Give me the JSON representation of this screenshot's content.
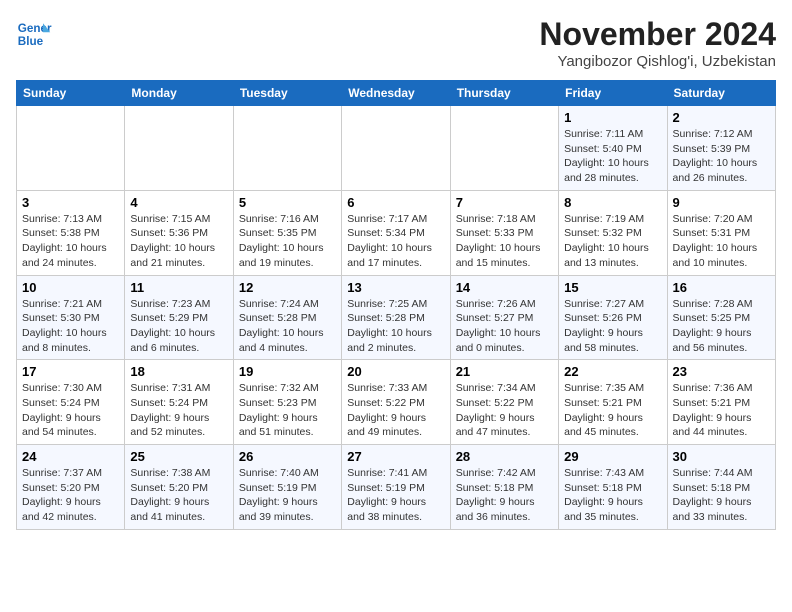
{
  "header": {
    "logo_line1": "General",
    "logo_line2": "Blue",
    "month": "November 2024",
    "location": "Yangibozor Qishlog'i, Uzbekistan"
  },
  "weekdays": [
    "Sunday",
    "Monday",
    "Tuesday",
    "Wednesday",
    "Thursday",
    "Friday",
    "Saturday"
  ],
  "weeks": [
    [
      {
        "day": "",
        "info": ""
      },
      {
        "day": "",
        "info": ""
      },
      {
        "day": "",
        "info": ""
      },
      {
        "day": "",
        "info": ""
      },
      {
        "day": "",
        "info": ""
      },
      {
        "day": "1",
        "info": "Sunrise: 7:11 AM\nSunset: 5:40 PM\nDaylight: 10 hours and 28 minutes."
      },
      {
        "day": "2",
        "info": "Sunrise: 7:12 AM\nSunset: 5:39 PM\nDaylight: 10 hours and 26 minutes."
      }
    ],
    [
      {
        "day": "3",
        "info": "Sunrise: 7:13 AM\nSunset: 5:38 PM\nDaylight: 10 hours and 24 minutes."
      },
      {
        "day": "4",
        "info": "Sunrise: 7:15 AM\nSunset: 5:36 PM\nDaylight: 10 hours and 21 minutes."
      },
      {
        "day": "5",
        "info": "Sunrise: 7:16 AM\nSunset: 5:35 PM\nDaylight: 10 hours and 19 minutes."
      },
      {
        "day": "6",
        "info": "Sunrise: 7:17 AM\nSunset: 5:34 PM\nDaylight: 10 hours and 17 minutes."
      },
      {
        "day": "7",
        "info": "Sunrise: 7:18 AM\nSunset: 5:33 PM\nDaylight: 10 hours and 15 minutes."
      },
      {
        "day": "8",
        "info": "Sunrise: 7:19 AM\nSunset: 5:32 PM\nDaylight: 10 hours and 13 minutes."
      },
      {
        "day": "9",
        "info": "Sunrise: 7:20 AM\nSunset: 5:31 PM\nDaylight: 10 hours and 10 minutes."
      }
    ],
    [
      {
        "day": "10",
        "info": "Sunrise: 7:21 AM\nSunset: 5:30 PM\nDaylight: 10 hours and 8 minutes."
      },
      {
        "day": "11",
        "info": "Sunrise: 7:23 AM\nSunset: 5:29 PM\nDaylight: 10 hours and 6 minutes."
      },
      {
        "day": "12",
        "info": "Sunrise: 7:24 AM\nSunset: 5:28 PM\nDaylight: 10 hours and 4 minutes."
      },
      {
        "day": "13",
        "info": "Sunrise: 7:25 AM\nSunset: 5:28 PM\nDaylight: 10 hours and 2 minutes."
      },
      {
        "day": "14",
        "info": "Sunrise: 7:26 AM\nSunset: 5:27 PM\nDaylight: 10 hours and 0 minutes."
      },
      {
        "day": "15",
        "info": "Sunrise: 7:27 AM\nSunset: 5:26 PM\nDaylight: 9 hours and 58 minutes."
      },
      {
        "day": "16",
        "info": "Sunrise: 7:28 AM\nSunset: 5:25 PM\nDaylight: 9 hours and 56 minutes."
      }
    ],
    [
      {
        "day": "17",
        "info": "Sunrise: 7:30 AM\nSunset: 5:24 PM\nDaylight: 9 hours and 54 minutes."
      },
      {
        "day": "18",
        "info": "Sunrise: 7:31 AM\nSunset: 5:24 PM\nDaylight: 9 hours and 52 minutes."
      },
      {
        "day": "19",
        "info": "Sunrise: 7:32 AM\nSunset: 5:23 PM\nDaylight: 9 hours and 51 minutes."
      },
      {
        "day": "20",
        "info": "Sunrise: 7:33 AM\nSunset: 5:22 PM\nDaylight: 9 hours and 49 minutes."
      },
      {
        "day": "21",
        "info": "Sunrise: 7:34 AM\nSunset: 5:22 PM\nDaylight: 9 hours and 47 minutes."
      },
      {
        "day": "22",
        "info": "Sunrise: 7:35 AM\nSunset: 5:21 PM\nDaylight: 9 hours and 45 minutes."
      },
      {
        "day": "23",
        "info": "Sunrise: 7:36 AM\nSunset: 5:21 PM\nDaylight: 9 hours and 44 minutes."
      }
    ],
    [
      {
        "day": "24",
        "info": "Sunrise: 7:37 AM\nSunset: 5:20 PM\nDaylight: 9 hours and 42 minutes."
      },
      {
        "day": "25",
        "info": "Sunrise: 7:38 AM\nSunset: 5:20 PM\nDaylight: 9 hours and 41 minutes."
      },
      {
        "day": "26",
        "info": "Sunrise: 7:40 AM\nSunset: 5:19 PM\nDaylight: 9 hours and 39 minutes."
      },
      {
        "day": "27",
        "info": "Sunrise: 7:41 AM\nSunset: 5:19 PM\nDaylight: 9 hours and 38 minutes."
      },
      {
        "day": "28",
        "info": "Sunrise: 7:42 AM\nSunset: 5:18 PM\nDaylight: 9 hours and 36 minutes."
      },
      {
        "day": "29",
        "info": "Sunrise: 7:43 AM\nSunset: 5:18 PM\nDaylight: 9 hours and 35 minutes."
      },
      {
        "day": "30",
        "info": "Sunrise: 7:44 AM\nSunset: 5:18 PM\nDaylight: 9 hours and 33 minutes."
      }
    ]
  ]
}
